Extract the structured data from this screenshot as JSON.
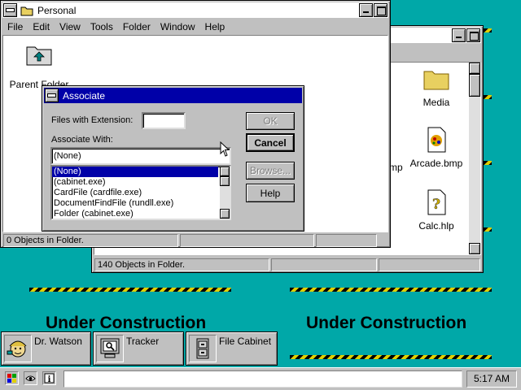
{
  "personal_window": {
    "title": "Personal",
    "menu": [
      "File",
      "Edit",
      "View",
      "Tools",
      "Folder",
      "Window",
      "Help"
    ],
    "parent_folder_label": "Parent Folder",
    "status": "0 Objects in Folder."
  },
  "back_window": {
    "files": [
      {
        "label": "Media",
        "icon": "folder-icon"
      },
      {
        "label": "Arcade.bmp",
        "icon": "bitmap-icon"
      },
      {
        "label": "Calc.hlp",
        "icon": "help-file-icon"
      }
    ],
    "partial_label": "mp",
    "status": "140 Objects in Folder."
  },
  "associate_dialog": {
    "title": "Associate",
    "extension_label": "Files with Extension:",
    "extension_value": "",
    "associate_label": "Associate With:",
    "combo_value": "(None)",
    "list": [
      "(None)",
      "(cabinet.exe)",
      "CardFile (cardfile.exe)",
      "DocumentFindFile (rundll.exe)",
      "Folder (cabinet.exe)"
    ],
    "ok_label": "OK",
    "cancel_label": "Cancel",
    "browse_label": "Browse...",
    "help_label": "Help"
  },
  "desktop": {
    "construction_left": "Under Construction",
    "construction_right": "Under Construction"
  },
  "dock": [
    {
      "label": "Dr. Watson",
      "icon": "dr-watson-icon"
    },
    {
      "label": "Tracker",
      "icon": "tracker-monitor-icon"
    },
    {
      "label": "File Cabinet",
      "icon": "file-cabinet-icon"
    }
  ],
  "taskbar": {
    "clock": "5:17 AM"
  },
  "colors": {
    "desktop": "#00a8a8",
    "active_title": "#0000a8",
    "window_face": "#c0c0c0"
  }
}
